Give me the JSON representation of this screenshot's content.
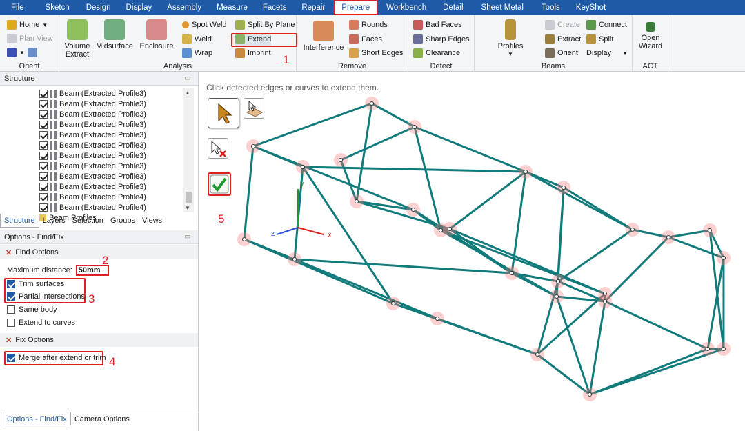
{
  "menu": {
    "tabs": [
      "File",
      "Sketch",
      "Design",
      "Display",
      "Assembly",
      "Measure",
      "Facets",
      "Repair",
      "Prepare",
      "Workbench",
      "Detail",
      "Sheet Metal",
      "Tools",
      "KeyShot"
    ],
    "active": "Prepare"
  },
  "ribbon": {
    "orient": {
      "home": "Home",
      "plan_view": "Plan View",
      "title": "Orient"
    },
    "analysis": {
      "volume_extract": "Volume\nExtract",
      "midsurface": "Midsurface",
      "enclosure": "Enclosure",
      "spot_weld": "Spot Weld",
      "weld": "Weld",
      "wrap": "Wrap",
      "split_by_plane": "Split By Plane",
      "extend": "Extend",
      "imprint": "Imprint",
      "title": "Analysis"
    },
    "remove": {
      "interference": "Interference",
      "rounds": "Rounds",
      "faces": "Faces",
      "short_edges": "Short Edges",
      "title": "Remove"
    },
    "detect": {
      "bad_faces": "Bad Faces",
      "sharp_edges": "Sharp Edges",
      "clearance": "Clearance",
      "title": "Detect"
    },
    "beams": {
      "profiles": "Profiles",
      "create": "Create",
      "extract": "Extract",
      "orient": "Orient",
      "connect": "Connect",
      "split": "Split",
      "display": "Display",
      "title": "Beams"
    },
    "act": {
      "open_wizard": "Open\nWizard",
      "title": "ACT"
    }
  },
  "annotations": {
    "n1": "1",
    "n2": "2",
    "n3": "3",
    "n4": "4",
    "n5": "5"
  },
  "structure": {
    "title": "Structure",
    "items": [
      "Beam (Extracted Profile3)",
      "Beam (Extracted Profile3)",
      "Beam (Extracted Profile3)",
      "Beam (Extracted Profile3)",
      "Beam (Extracted Profile3)",
      "Beam (Extracted Profile3)",
      "Beam (Extracted Profile3)",
      "Beam (Extracted Profile3)",
      "Beam (Extracted Profile3)",
      "Beam (Extracted Profile3)",
      "Beam (Extracted Profile4)",
      "Beam (Extracted Profile4)"
    ],
    "folder": "Beam Profiles",
    "tabs": [
      "Structure",
      "Layers",
      "Selection",
      "Groups",
      "Views"
    ]
  },
  "options": {
    "title": "Options - Find/Fix",
    "find_options": "Find Options",
    "max_distance_label": "Maximum distance:",
    "max_distance_value": "50mm",
    "trim_surfaces": "Trim surfaces",
    "partial_intersections": "Partial intersections",
    "same_body": "Same body",
    "extend_to_curves": "Extend to curves",
    "fix_options": "Fix Options",
    "merge": "Merge after extend or trim",
    "bottom_tabs": [
      "Options - Find/Fix",
      "Camera Options"
    ]
  },
  "viewport": {
    "hint": "Click detected edges or curves to extend them.",
    "axis_x": "x",
    "axis_y": "y",
    "axis_z": "z"
  },
  "colors": {
    "accent": "#1f5aa6",
    "beam": "#117a7a",
    "highlight": "#e02020"
  }
}
